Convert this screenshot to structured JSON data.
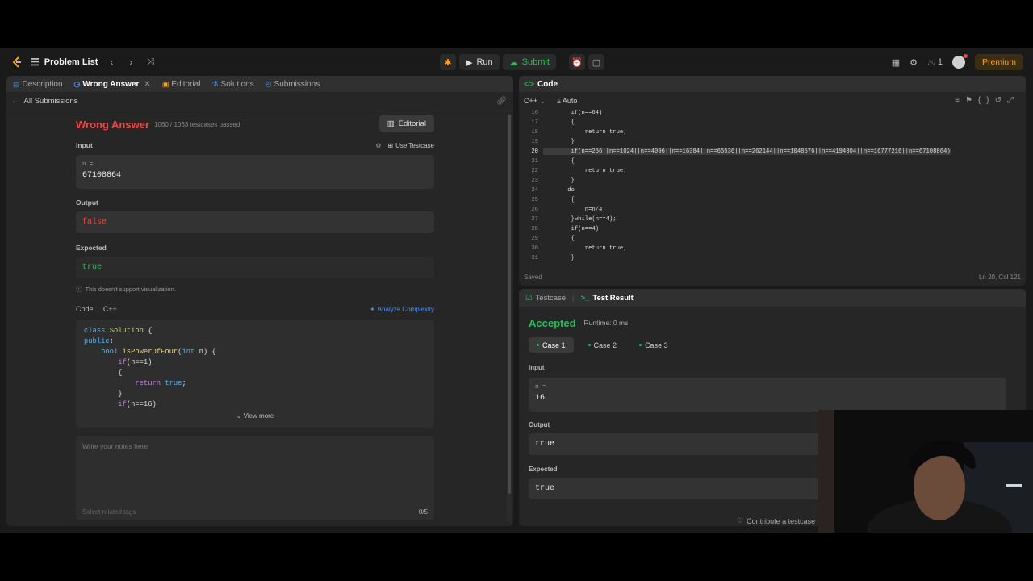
{
  "topbar": {
    "problem_list": "Problem List",
    "run": "Run",
    "submit": "Submit",
    "streak_count": "1",
    "premium": "Premium"
  },
  "left_tabs": [
    "Description",
    "Wrong Answer",
    "Editorial",
    "Solutions",
    "Submissions"
  ],
  "breadcrumb": "All Submissions",
  "result": {
    "status": "Wrong Answer",
    "passed": "1060 / 1063 testcases passed",
    "editorial_btn": "Editorial",
    "input_label": "Input",
    "use_testcase": "Use Testcase",
    "input_var": "n =",
    "input_value": "67108864",
    "output_label": "Output",
    "output_value": "false",
    "expected_label": "Expected",
    "expected_value": "true",
    "no_visual": "This doesn't support visualization.",
    "code_label": "Code",
    "code_lang": "C++",
    "analyze": "Analyze Complexity",
    "view_more": "View more",
    "notes_placeholder": "Write your notes here",
    "tags_placeholder": "Select related tags",
    "notes_count": "0/5"
  },
  "code_snippet": [
    "class Solution {",
    "public:",
    "    bool isPowerOfFour(int n) {",
    "        if(n==1)",
    "        {",
    "            return true;",
    "        }",
    "        if(n==16)"
  ],
  "code_panel": {
    "title": "Code",
    "lang": "C++",
    "mode": "Auto",
    "saved": "Saved",
    "cursor": "Ln 20, Col 121",
    "lines": [
      {
        "n": "16",
        "t": "        if(n==64)"
      },
      {
        "n": "17",
        "t": "        {"
      },
      {
        "n": "18",
        "t": "            return true;"
      },
      {
        "n": "19",
        "t": "        }"
      },
      {
        "n": "20",
        "t": "        if(n==256||n==1024||n==4096||n==16384||n==65536||n==262144||n==1048576||n==4194304||n==16777216||n==67108864)"
      },
      {
        "n": "21",
        "t": "        {"
      },
      {
        "n": "22",
        "t": "            return true;"
      },
      {
        "n": "23",
        "t": "        }"
      },
      {
        "n": "24",
        "t": "       do"
      },
      {
        "n": "25",
        "t": "        {"
      },
      {
        "n": "26",
        "t": "            n=n/4;"
      },
      {
        "n": "27",
        "t": "        }while(n==4);"
      },
      {
        "n": "28",
        "t": "        if(n==4)"
      },
      {
        "n": "29",
        "t": "        {"
      },
      {
        "n": "30",
        "t": "            return true;"
      },
      {
        "n": "31",
        "t": "        }"
      }
    ]
  },
  "test_panel": {
    "tab_testcase": "Testcase",
    "tab_result": "Test Result",
    "status": "Accepted",
    "runtime": "Runtime: 0 ms",
    "cases": [
      "Case 1",
      "Case 2",
      "Case 3"
    ],
    "input_label": "Input",
    "input_var": "n =",
    "input_value": "16",
    "output_label": "Output",
    "output_value": "true",
    "expected_label": "Expected",
    "expected_value": "true",
    "contribute": "Contribute a testcase"
  },
  "colors": {
    "accent_orange": "#ffa116",
    "wrong_red": "#ef4743",
    "accepted_green": "#2cbb5d",
    "tab_blue": "#4a8ff7"
  }
}
